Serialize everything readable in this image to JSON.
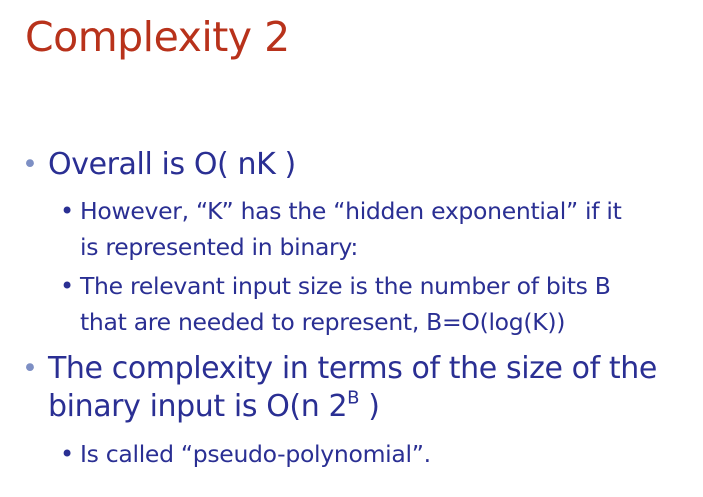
{
  "slide": {
    "title": "Complexity 2",
    "bullet_1": "Overall is O( nK )",
    "bullet_1_1_line1": "However, “K” has the “hidden exponential” if it",
    "bullet_1_1_line2": "is represented in binary:",
    "bullet_1_2_line1": "The relevant input size is the number of bits B",
    "bullet_1_2_line2": "that are needed to represent, B=O(log(K))",
    "bullet_2_line1": "The complexity in terms of the size of the",
    "bullet_2_line2_prefix": "binary input is  O(n 2",
    "bullet_2_line2_sup": "B",
    "bullet_2_line2_suffix": " )",
    "bullet_2_1": "Is called “pseudo-polynomial”.",
    "colors": {
      "title": "#b8321b",
      "body": "#2a2f93",
      "bullet_marker": "#7d8fc4"
    }
  }
}
